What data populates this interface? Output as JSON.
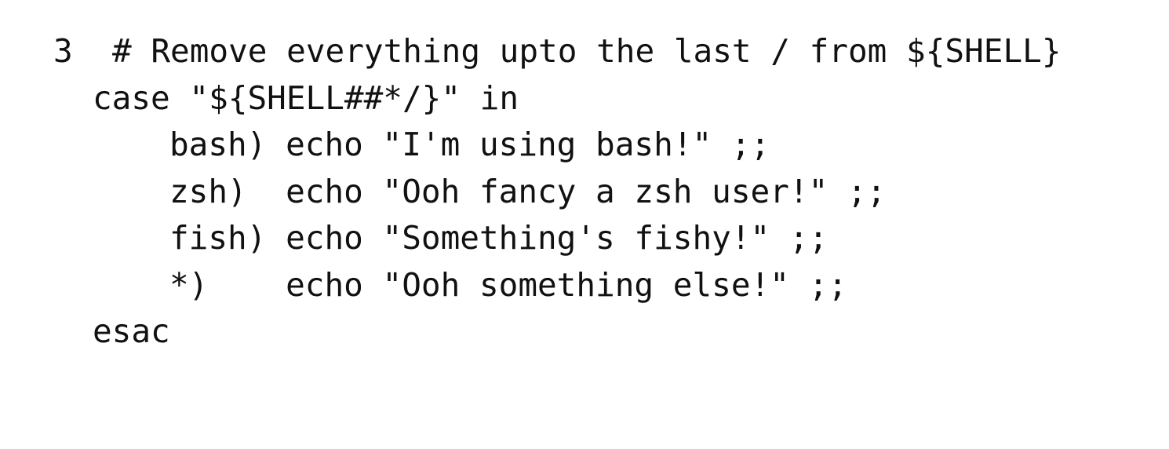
{
  "editor": {
    "line_number": "3",
    "lines": [
      "# Remove everything upto the last / from ${SHELL}",
      "case \"${SHELL##*/}\" in",
      "bash) echo \"I'm using bash!\" ;;",
      "zsh)  echo \"Ooh fancy a zsh user!\" ;;",
      "fish) echo \"Something's fishy!\" ;;",
      "*)    echo \"Ooh something else!\" ;;",
      "esac"
    ],
    "text_color": "#111111",
    "background_color": "#ffffff"
  }
}
